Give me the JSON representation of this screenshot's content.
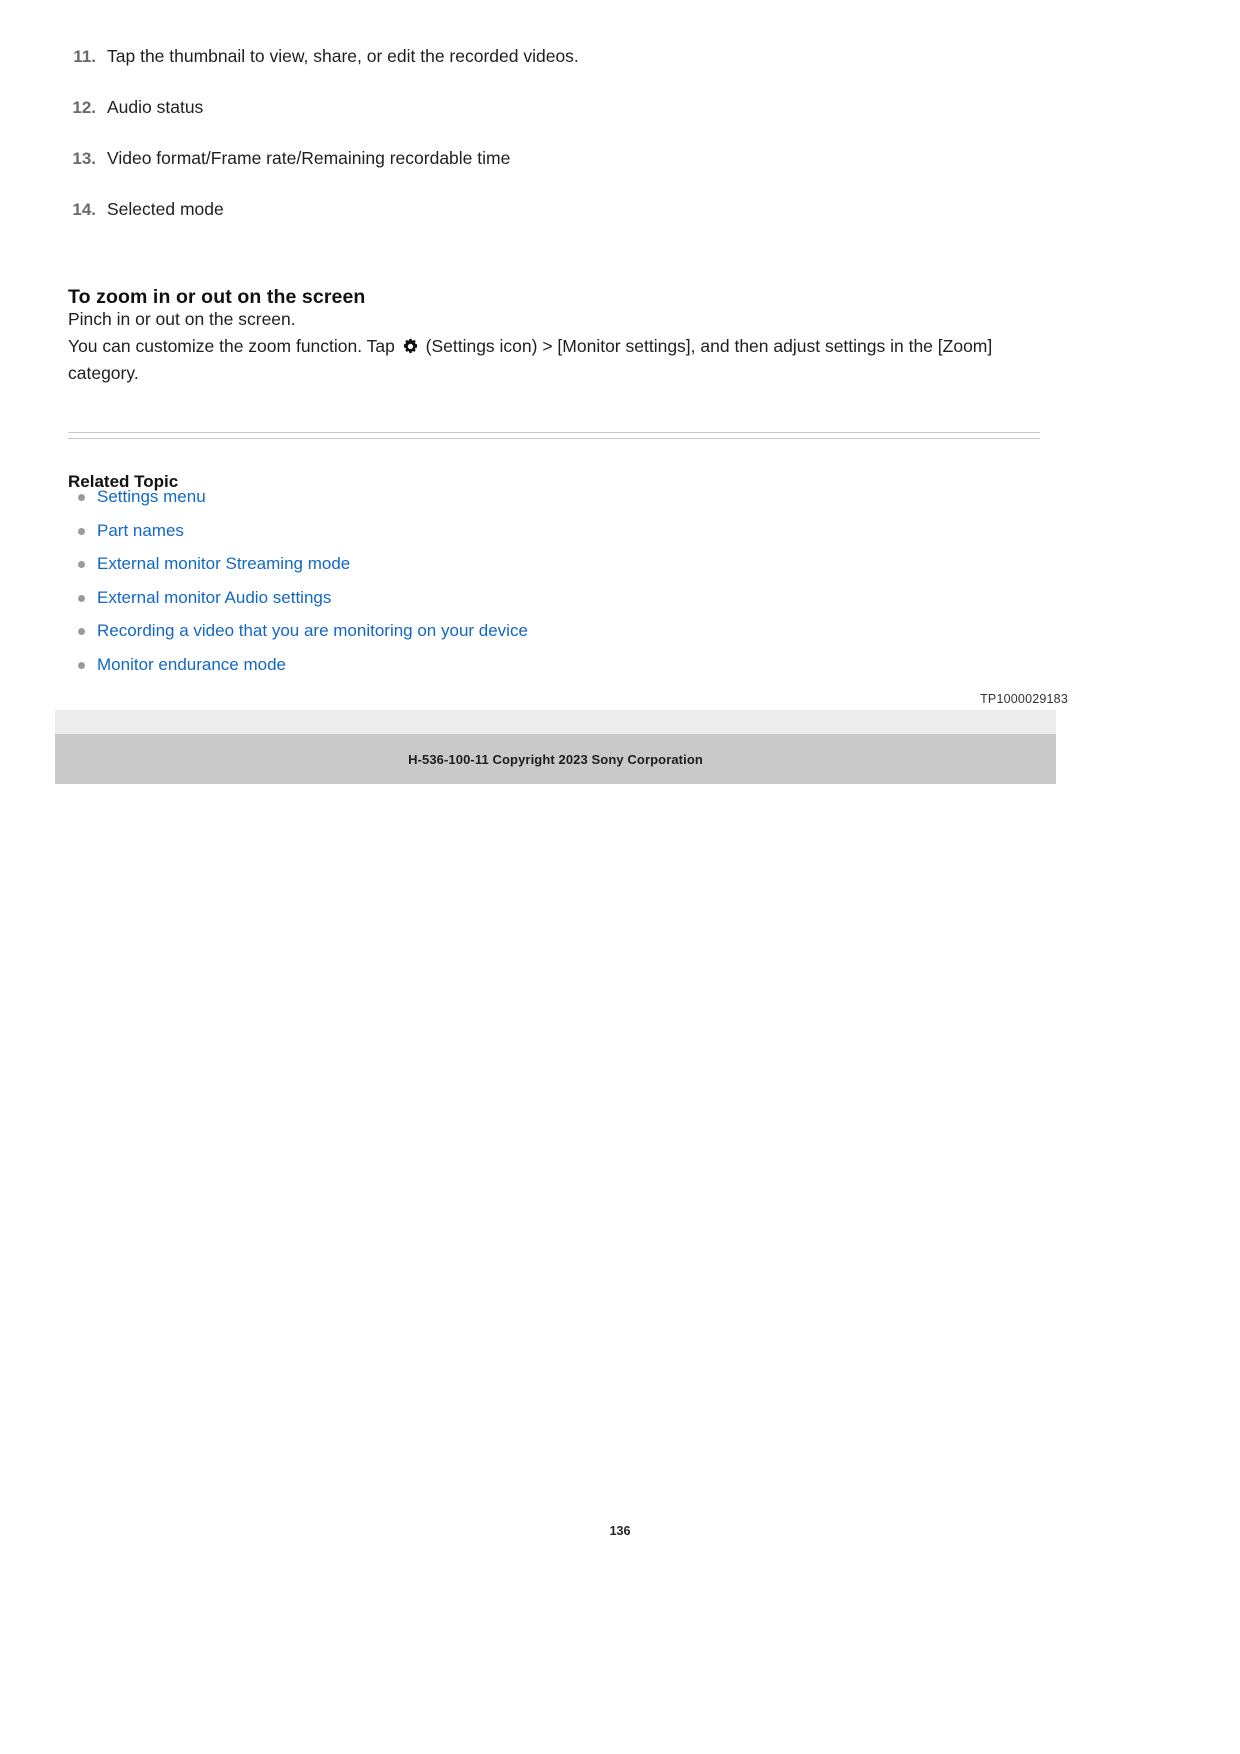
{
  "steps": [
    {
      "number": "11.",
      "text": "Tap the thumbnail to view, share, or edit the recorded videos."
    },
    {
      "number": "12.",
      "text": "Audio status"
    },
    {
      "number": "13.",
      "text": "Video format/Frame rate/Remaining recordable time"
    },
    {
      "number": "14.",
      "text": "Selected mode"
    }
  ],
  "section": {
    "heading": "To zoom in or out on the screen",
    "line1": "Pinch in or out on the screen.",
    "line2_before_icon": "You can customize the zoom function. Tap",
    "icon_name": "settings-gear-icon",
    "line2_after_icon": "(Settings icon) > [Monitor settings], and then adjust settings in the [Zoom] category."
  },
  "related": {
    "title": "Related Topic",
    "links": [
      "Settings menu",
      "Part names",
      "External monitor Streaming mode",
      "External monitor Audio settings",
      "Recording a video that you are monitoring on your device",
      "Monitor endurance mode"
    ]
  },
  "footer": {
    "tp_code": "TP1000029183",
    "copyright": "H-536-100-11 Copyright 2023 Sony Corporation",
    "page_number": "136"
  },
  "colors": {
    "link": "#1268c3",
    "marker": "#6a6a6a",
    "footer_light": "#ececec",
    "footer_dark": "#c9c9c9"
  }
}
